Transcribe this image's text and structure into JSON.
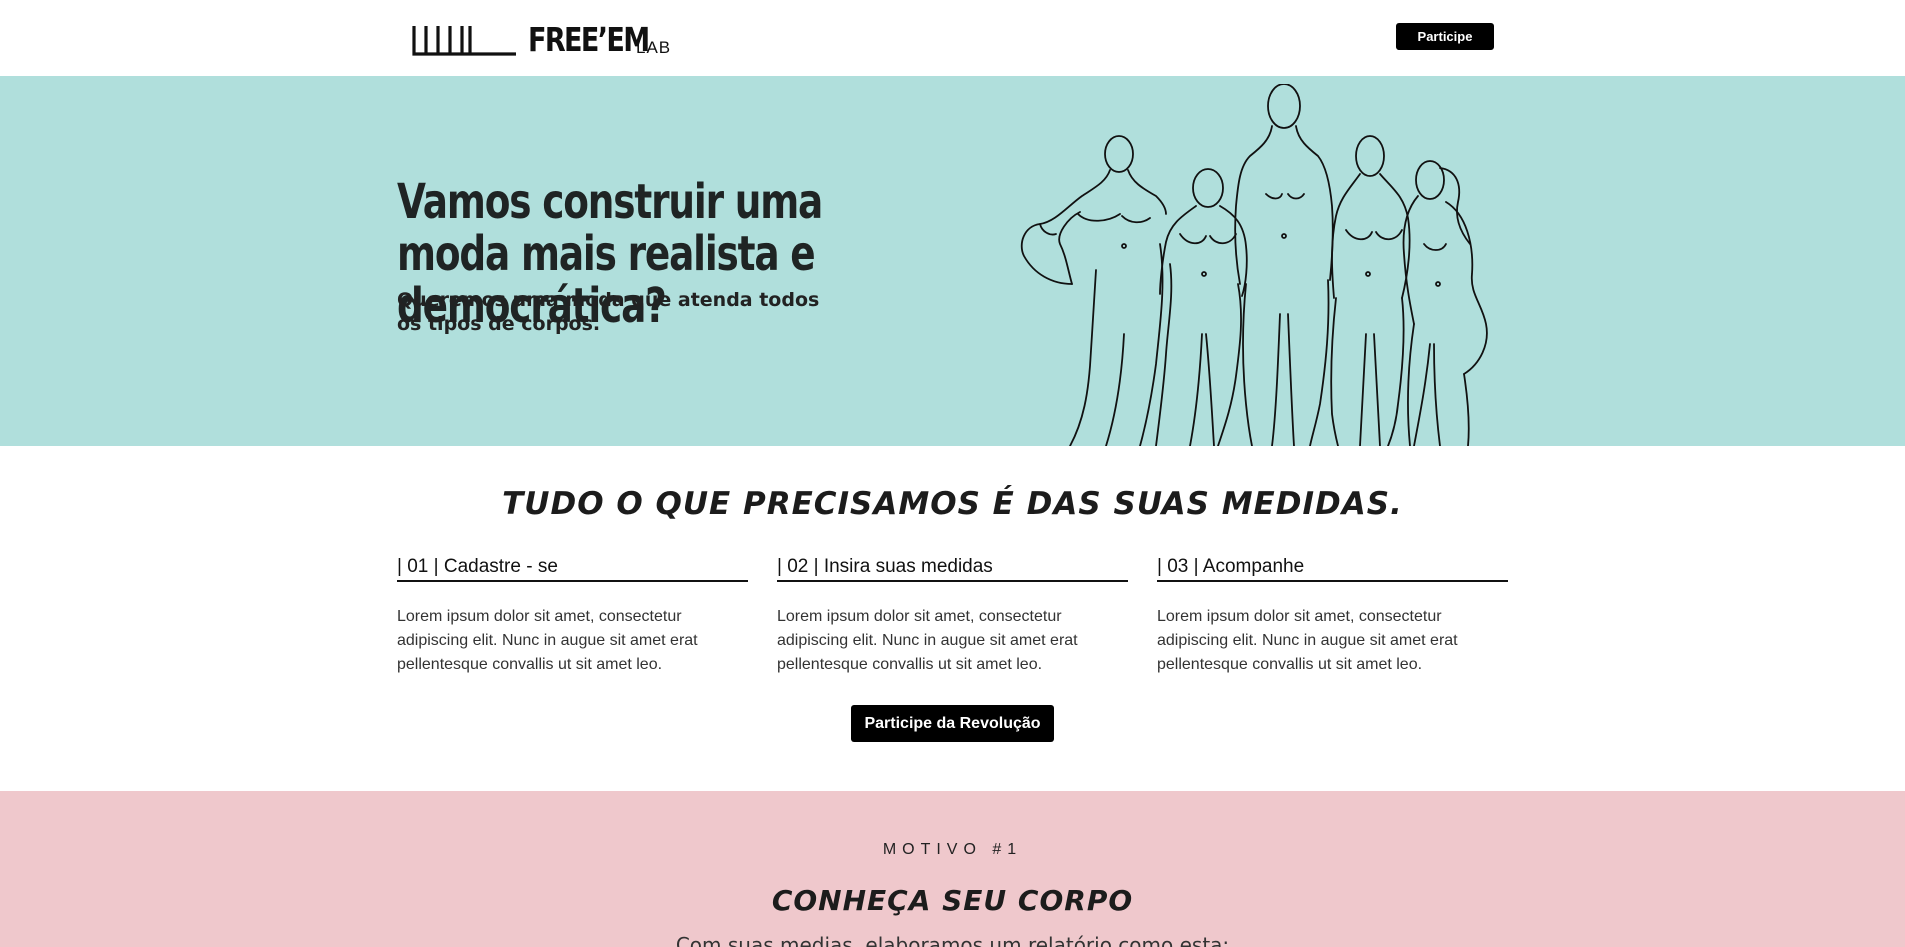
{
  "header": {
    "brand": "FREE’EM",
    "brand_sub": "LAB",
    "cta_label": "Participe"
  },
  "hero": {
    "title": "Vamos construir uma moda mais realista e democrática?",
    "subtitle": "Queremos uma moda que atenda todos os tipos de corpos.",
    "illustration_icon": "body-silhouettes-illustration"
  },
  "steps": {
    "title": "TUDO O QUE PRECISAMOS É DAS SUAS MEDIDAS.",
    "items": [
      {
        "label": "| 01 | Cadastre - se",
        "text": "Lorem ipsum dolor sit amet, consectetur adipiscing elit. Nunc in augue sit amet erat pellentesque convallis ut sit amet leo."
      },
      {
        "label": "| 02 | Insira suas medidas",
        "text": "Lorem ipsum dolor sit amet, consectetur adipiscing elit. Nunc in augue sit amet erat pellentesque convallis ut sit amet leo."
      },
      {
        "label": "| 03 | Acompanhe",
        "text": "Lorem ipsum dolor sit amet, consectetur adipiscing elit. Nunc in augue sit amet erat pellentesque convallis ut sit amet leo."
      }
    ],
    "cta_label": "Participe da Revolução"
  },
  "motivo": {
    "kicker": "MOTIVO #1",
    "title": "CONHEÇA SEU CORPO",
    "text": "Com suas medias, elaboramos um relatório como esta:"
  },
  "colors": {
    "hero_bg": "#b0dfdc",
    "pink_bg": "#efc8cc",
    "button_bg": "#000000",
    "text_dark": "#1f2424"
  }
}
